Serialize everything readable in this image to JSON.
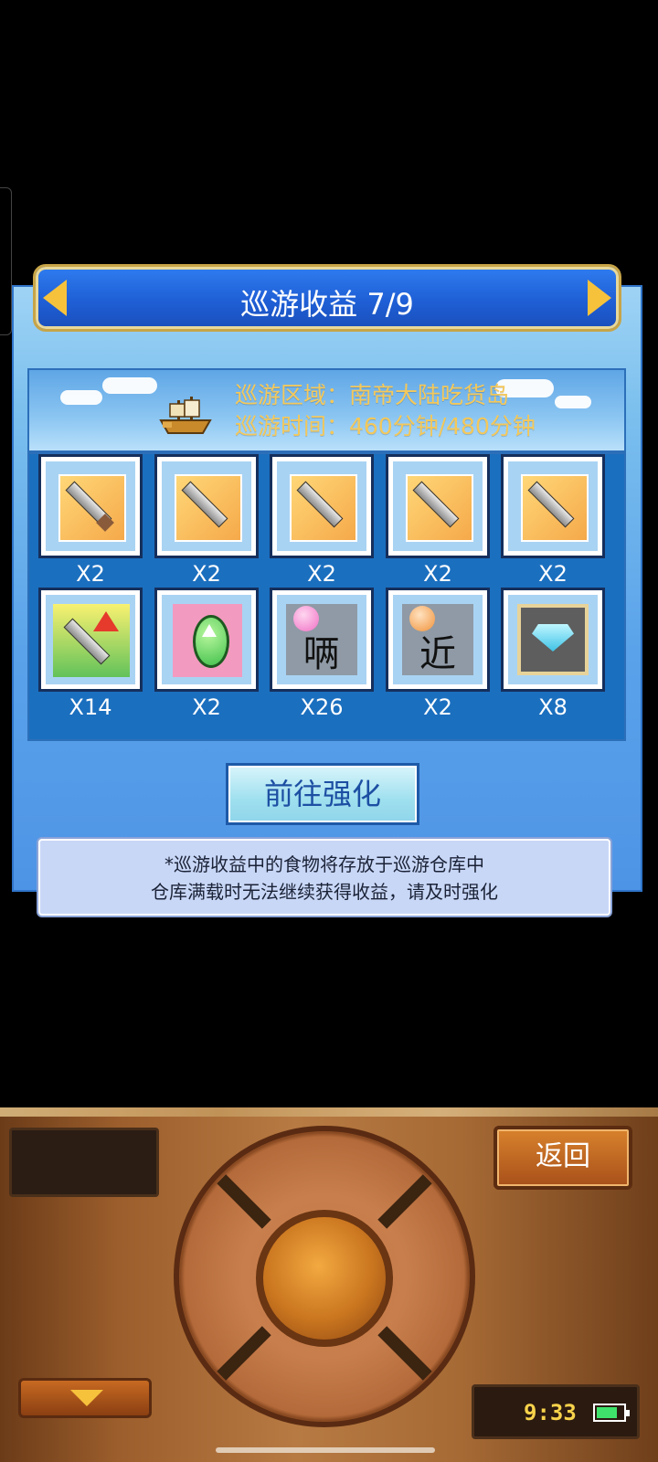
{
  "panel": {
    "title": "巡游收益 7/9",
    "cruise_area": "巡游区域：南帝大陆吃货岛",
    "cruise_time": "巡游时间：460分钟/480分钟",
    "enhance_button": "前往强化",
    "note_line1": "*巡游收益中的食物将存放于巡游仓库中",
    "note_line2": "仓库满载时无法继续获得收益，请及时强化"
  },
  "rewards": [
    {
      "icon": "sword-card-icon",
      "qty": "X2"
    },
    {
      "icon": "sword-card-icon",
      "qty": "X2"
    },
    {
      "icon": "sword-card-icon",
      "qty": "X2"
    },
    {
      "icon": "sword-card-icon",
      "qty": "X2"
    },
    {
      "icon": "sword-card-icon",
      "qty": "X2"
    },
    {
      "icon": "sword-upgrade-icon",
      "qty": "X14"
    },
    {
      "icon": "green-egg-icon",
      "qty": "X2"
    },
    {
      "icon": "candy-scroll-icon",
      "qty": "X26"
    },
    {
      "icon": "orange-scroll-icon",
      "qty": "X2"
    },
    {
      "icon": "diamond-icon",
      "qty": "X8"
    }
  ],
  "controller": {
    "back_button": "返回",
    "time": "9:33",
    "battery_level": 0.8
  },
  "colors": {
    "title_bar": "#1f5fd6",
    "banner_text": "#f4c85a",
    "accent_gold": "#f6c23c"
  }
}
